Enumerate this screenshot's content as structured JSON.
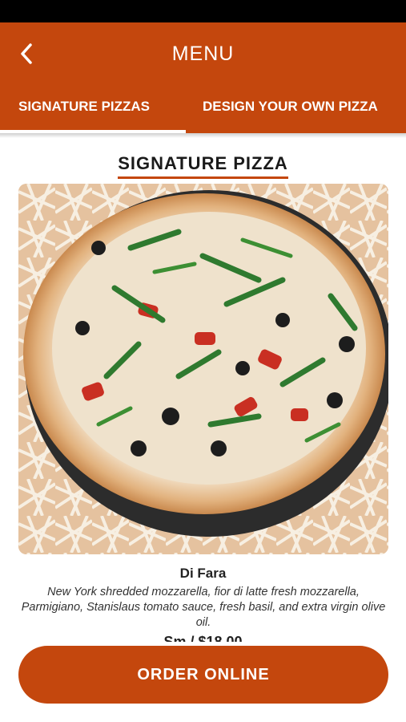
{
  "header": {
    "title": "MENU"
  },
  "tabs": [
    {
      "label": "SIGNATURE PIZZAS",
      "active": true
    },
    {
      "label": "DESIGN YOUR OWN PIZZA",
      "active": false
    }
  ],
  "section": {
    "title": "SIGNATURE PIZZA"
  },
  "item": {
    "name": "Di Fara",
    "description": "New York shredded mozzarella, fior di latte fresh mozzarella, Parmigiano, Stanislaus tomato sauce, fresh basil, and extra virgin olive oil.",
    "price": "Sm / $18.00"
  },
  "order_button": {
    "label": "ORDER ONLINE"
  },
  "colors": {
    "brand": "#c4470d",
    "statusbar": "#000000"
  },
  "icons": {
    "back": "chevron-left-icon"
  }
}
